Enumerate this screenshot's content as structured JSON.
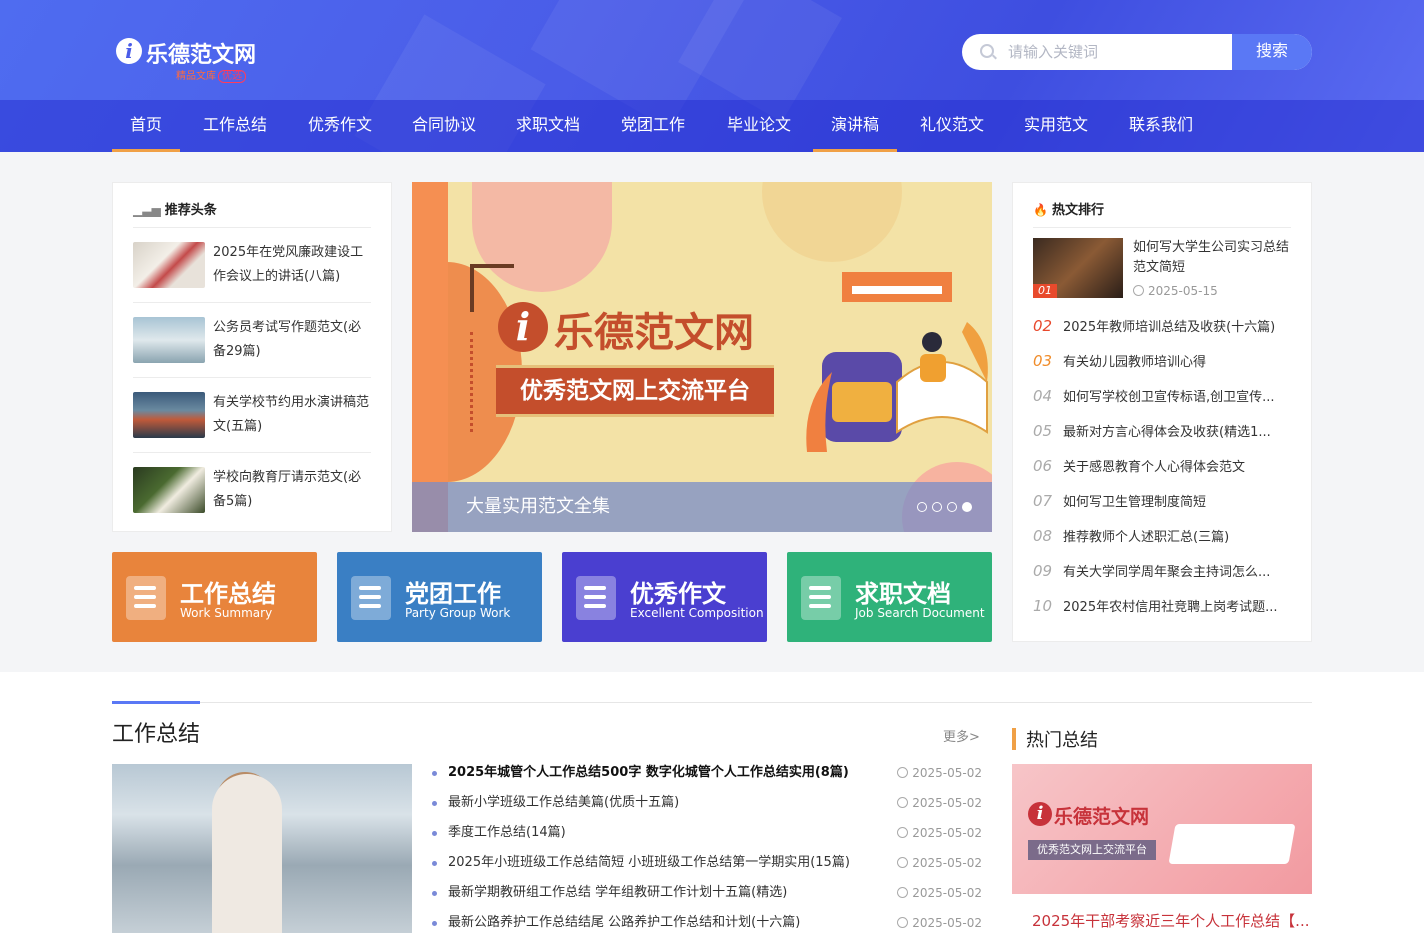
{
  "header": {
    "logo_text": "乐德范文网",
    "logo_sub": "精品文库",
    "logo_tag": "优选",
    "search_placeholder": "请输入关键词",
    "search_button": "搜索"
  },
  "nav": [
    {
      "label": "首页",
      "active": true
    },
    {
      "label": "工作总结",
      "active": false
    },
    {
      "label": "优秀作文",
      "active": false
    },
    {
      "label": "合同协议",
      "active": false
    },
    {
      "label": "求职文档",
      "active": false
    },
    {
      "label": "党团工作",
      "active": false
    },
    {
      "label": "毕业论文",
      "active": false
    },
    {
      "label": "演讲稿",
      "active": true
    },
    {
      "label": "礼仪范文",
      "active": false
    },
    {
      "label": "实用范文",
      "active": false
    },
    {
      "label": "联系我们",
      "active": false
    }
  ],
  "recommend": {
    "title": "推荐头条",
    "items": [
      {
        "title": "2025年在党风廉政建设工作会议上的讲话(八篇)"
      },
      {
        "title": "公务员考试写作题范文(必备29篇)"
      },
      {
        "title": "有关学校节约用水演讲稿范文(五篇)"
      },
      {
        "title": "学校向教育厅请示范文(必备5篇)"
      }
    ]
  },
  "banner": {
    "logo_text": "乐德范文网",
    "slogan": "优秀范文网上交流平台",
    "caption": "大量实用范文全集",
    "active_dot": 4,
    "dot_count": 4
  },
  "hot": {
    "title": "热文排行",
    "first": {
      "num": "01",
      "title": "如何写大学生公司实习总结范文简短",
      "date": "2025-05-15"
    },
    "items": [
      {
        "num": "02",
        "title": "2025年教师培训总结及收获(十六篇)",
        "color": "#e8482c"
      },
      {
        "num": "03",
        "title": "有关幼儿园教师培训心得",
        "color": "#f08c2a"
      },
      {
        "num": "04",
        "title": "如何写学校创卫宣传标语,创卫宣传...",
        "color": "#aaaaaa"
      },
      {
        "num": "05",
        "title": "最新对方言心得体会及收获(精选1...",
        "color": "#aaaaaa"
      },
      {
        "num": "06",
        "title": "关于感恩教育个人心得体会范文",
        "color": "#aaaaaa"
      },
      {
        "num": "07",
        "title": "如何写卫生管理制度简短",
        "color": "#aaaaaa"
      },
      {
        "num": "08",
        "title": "推荐教师个人述职汇总(三篇)",
        "color": "#aaaaaa"
      },
      {
        "num": "09",
        "title": "有关大学同学周年聚会主持词怎么...",
        "color": "#aaaaaa"
      },
      {
        "num": "10",
        "title": "2025年农村信用社竞聘上岗考试题...",
        "color": "#aaaaaa"
      }
    ]
  },
  "categories": [
    {
      "title": "工作总结",
      "sub": "Work Summary",
      "color": "#e8843c"
    },
    {
      "title": "党团工作",
      "sub": "Party Group Work",
      "color": "#3a7fc4"
    },
    {
      "title": "优秀作文",
      "sub": "Excellent Composition",
      "color": "#4a3fd0"
    },
    {
      "title": "求职文档",
      "sub": "Job Search Document",
      "color": "#2fb27a"
    }
  ],
  "section": {
    "title": "工作总结",
    "more": "更多>",
    "articles": [
      {
        "title": "2025年城管个人工作总结500字 数字化城管个人工作总结实用(8篇)",
        "date": "2025-05-02",
        "bold": true
      },
      {
        "title": "最新小学班级工作总结美篇(优质十五篇)",
        "date": "2025-05-02",
        "bold": false
      },
      {
        "title": "季度工作总结(14篇)",
        "date": "2025-05-02",
        "bold": false
      },
      {
        "title": "2025年小班班级工作总结简短 小班班级工作总结第一学期实用(15篇)",
        "date": "2025-05-02",
        "bold": false
      },
      {
        "title": "最新学期教研组工作总结 学年组教研工作计划十五篇(精选)",
        "date": "2025-05-02",
        "bold": false
      },
      {
        "title": "最新公路养护工作总结结尾 公路养护工作总结和计划(十六篇)",
        "date": "2025-05-02",
        "bold": false
      }
    ],
    "side_title": "热门总结",
    "side_banner_logo": "乐德范文网",
    "side_banner_slogan": "优秀范文网上交流平台",
    "side_caption": "2025年干部考察近三年个人工作总结【..."
  }
}
